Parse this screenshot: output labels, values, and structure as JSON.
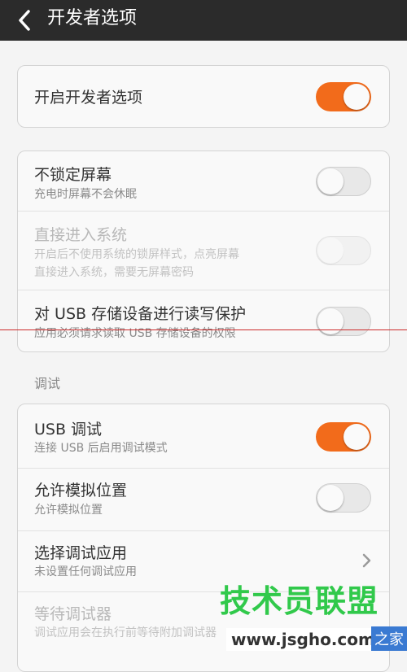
{
  "header": {
    "title": "开发者选项",
    "back_icon": "chevron-left-icon"
  },
  "master": {
    "label": "开启开发者选项",
    "enabled": true
  },
  "screen_group": {
    "items": [
      {
        "label": "不锁定屏幕",
        "sub": "充电时屏幕不会休眠",
        "enabled": false,
        "disabled": false
      },
      {
        "label": "直接进入系统",
        "sub1": "开启后不使用系统的锁屏样式，点亮屏幕",
        "sub2": "直接进入系统，需要无屏幕密码",
        "enabled": false,
        "disabled": true
      },
      {
        "label": "对 USB 存储设备进行读写保护",
        "sub": "应用必须请求读取 USB 存储设备的权限",
        "enabled": false,
        "disabled": false
      }
    ]
  },
  "debug_section": {
    "header": "调试"
  },
  "debug_group": {
    "items": [
      {
        "label": "USB 调试",
        "sub": "连接 USB 后启用调试模式",
        "enabled": true
      },
      {
        "label": "允许模拟位置",
        "sub": "允许模拟位置",
        "enabled": false
      },
      {
        "label": "选择调试应用",
        "sub": "未设置任何调试应用",
        "chevron_icon": "chevron-right-icon"
      },
      {
        "label": "等待调试器",
        "sub": "调试应用会在执行前等待附加调试器"
      }
    ]
  },
  "watermark": {
    "title": "技术员联盟",
    "url": "www.jsgho.com",
    "side": "之家"
  },
  "colors": {
    "accent": "#f26b1b",
    "titlebar": "#2b2b2b",
    "watermark_green": "#31c94b"
  }
}
